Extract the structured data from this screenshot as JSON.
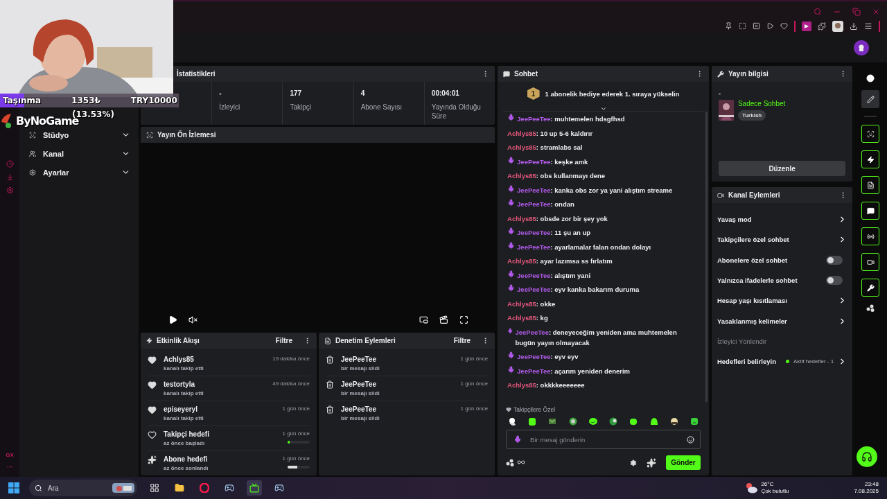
{
  "stream_overlay": {
    "goal_name": "Taşınma",
    "amount": "1353₺",
    "target": "TRY10000",
    "level": 0.1353,
    "percent": "(13.53%)",
    "brand": "ByNoGame"
  },
  "opera_sidebar": {
    "badge": "GX",
    "more": "···"
  },
  "sidebar": {
    "items": [
      {
        "label": "Stüdyo"
      },
      {
        "label": "Kanal"
      },
      {
        "label": "Ayarlar"
      }
    ]
  },
  "stats": {
    "title": "İstatistikleri",
    "items": [
      {
        "value": "-",
        "label": "İzleyici"
      },
      {
        "value": "177",
        "label": "Takipçi"
      },
      {
        "value": "4",
        "label": "Abone Sayısı"
      },
      {
        "value": "00:04:01",
        "label": "Yayında Olduğu Süre"
      }
    ]
  },
  "preview": {
    "title": "Yayın Ön İzlemesi"
  },
  "activity": {
    "title": "Etkinlik Akışı",
    "filter": "Filtre",
    "items": [
      {
        "kind": "follow",
        "name": "Achlys85",
        "detail": "kanalı takip etti",
        "time": "19 dakika önce"
      },
      {
        "kind": "follow",
        "name": "testortyla",
        "detail": "kanalı takip etti",
        "time": "49 dakika önce"
      },
      {
        "kind": "follow",
        "name": "episeyeryl",
        "detail": "kanalı takip etti",
        "time": "1 gün önce"
      },
      {
        "kind": "follower_goal",
        "name": "Takipçi hedefi",
        "detail": "az önce başladı",
        "time": "1 gün önce",
        "level": 0.1
      },
      {
        "kind": "sub_goal",
        "name": "Abone hedefi",
        "detail": "az önce sonlandı",
        "time": "1 gün önce",
        "level": 0.45
      }
    ]
  },
  "moderation": {
    "title": "Denetim Eylemleri",
    "filter": "Filtre",
    "items": [
      {
        "user": "JeePeeTee",
        "action": "bir mesajı sildi",
        "time": "1 gün önce"
      },
      {
        "user": "JeePeeTee",
        "action": "bir mesajı sildi",
        "time": "1 gün önce"
      },
      {
        "user": "JeePeeTee",
        "action": "bir mesajı sildi",
        "time": "1 gün önce"
      }
    ]
  },
  "chat": {
    "title": "Sohbet",
    "pinned": {
      "badge": "1",
      "text": "1 abonelik hediye ederek 1. sıraya yükselin"
    },
    "messages": [
      {
        "user": "JeePeeTee",
        "color": "#b05ae8",
        "badge": true,
        "text": ": muhtemelen hdsgfhsd"
      },
      {
        "user": "Achlys85",
        "color": "#e5587e",
        "badge": false,
        "text": ": 10 up 5-6 kaldırır"
      },
      {
        "user": "Achlys85",
        "color": "#e5587e",
        "badge": false,
        "text": ": stramlabs sal"
      },
      {
        "user": "JeePeeTee",
        "color": "#b05ae8",
        "badge": true,
        "text": ": keşke amk"
      },
      {
        "user": "Achlys85",
        "color": "#e5587e",
        "badge": false,
        "text": ": obs kullanmayı dene"
      },
      {
        "user": "JeePeeTee",
        "color": "#b05ae8",
        "badge": true,
        "text": ": kanka obs zor ya yani alıştım streame"
      },
      {
        "user": "JeePeeTee",
        "color": "#b05ae8",
        "badge": true,
        "text": ": ondan"
      },
      {
        "user": "Achlys85",
        "color": "#e5587e",
        "badge": false,
        "text": ": obsde zor bir şey yok"
      },
      {
        "user": "JeePeeTee",
        "color": "#b05ae8",
        "badge": true,
        "text": ": 11 şu an up"
      },
      {
        "user": "JeePeeTee",
        "color": "#b05ae8",
        "badge": true,
        "text": ": ayarlamalar falan ondan dolayı"
      },
      {
        "user": "Achlys85",
        "color": "#e5587e",
        "badge": false,
        "text": ": ayar lazımsa ss fırlatım"
      },
      {
        "user": "JeePeeTee",
        "color": "#b05ae8",
        "badge": true,
        "text": ": alıştım yani"
      },
      {
        "user": "JeePeeTee",
        "color": "#b05ae8",
        "badge": true,
        "text": ": eyv kanka bakarım duruma"
      },
      {
        "user": "Achlys85",
        "color": "#e5587e",
        "badge": false,
        "text": ": okke"
      },
      {
        "user": "Achlys85",
        "color": "#e5587e",
        "badge": false,
        "text": ": kg"
      },
      {
        "user": "JeePeeTee",
        "color": "#b05ae8",
        "badge": true,
        "text": ": deneyeceğim yeniden ama muhtemelen bugün yayın olmayacak"
      },
      {
        "user": "JeePeeTee",
        "color": "#b05ae8",
        "badge": true,
        "text": ": eyv eyv"
      },
      {
        "user": "JeePeeTee",
        "color": "#b05ae8",
        "badge": true,
        "text": ": açarım yeniden denerim"
      },
      {
        "user": "Achlys85",
        "color": "#e5587e",
        "badge": false,
        "text": ": okkkkeeeeeee"
      }
    ],
    "emote_label": "Takipçilere Özel",
    "input": {
      "placeholder": "Bir mesaj gönderin"
    },
    "send": "Gönder"
  },
  "stream_info": {
    "title": "Yayın bilgisi",
    "stream_title": "-",
    "category": "Sadece Sohbet",
    "tag": "Turkish",
    "edit": "Düzenle"
  },
  "channel_actions": {
    "title": "Kanal Eylemleri",
    "rows": [
      {
        "kind": "link",
        "label": "Yavaş mod"
      },
      {
        "kind": "link",
        "label": "Takipçilere özel sohbet"
      },
      {
        "kind": "toggle",
        "label": "Abonelere özel sohbet",
        "on": false
      },
      {
        "kind": "toggle",
        "label": "Yalnızca ifadelerle sohbet",
        "on": false
      },
      {
        "kind": "link",
        "label": "Hesap yaşı kısıtlaması"
      },
      {
        "kind": "link",
        "label": "Yasaklanmış kelimeler"
      },
      {
        "kind": "section",
        "label": "İzleyici Yönlendir"
      },
      {
        "kind": "goal",
        "label": "Hedefleri belirleyin",
        "status": "Aktif hedefler - 1"
      }
    ]
  },
  "taskbar": {
    "search": {
      "placeholder": "Ara"
    },
    "weather": {
      "temp": "26°C",
      "condition": "Çok bulutlu"
    },
    "time": "23:48",
    "date": "7.08.2025"
  }
}
